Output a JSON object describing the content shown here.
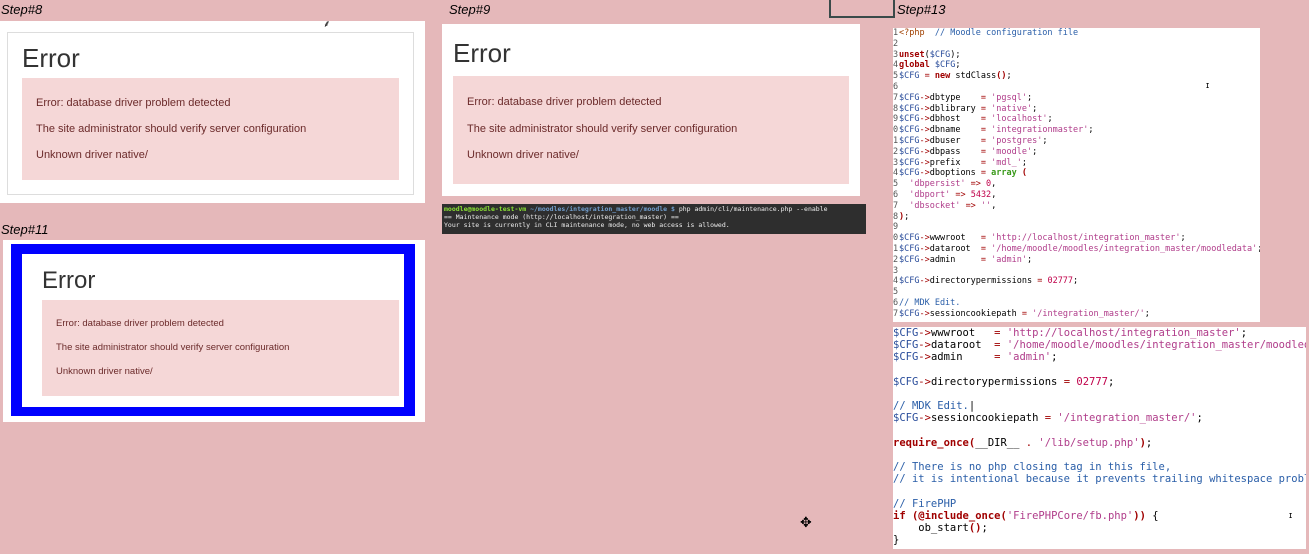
{
  "steps": {
    "step8": "Step#8",
    "step9": "Step#9",
    "step11": "Step#11",
    "step13": "Step#13"
  },
  "error": {
    "title": "Error",
    "line1": "Error: database driver problem detected",
    "line2": "The site administrator should verify server configuration",
    "line3": "Unknown driver native/"
  },
  "terminal": {
    "prompt_user": "moodle@moodle-test-vm",
    "prompt_path": "~/moodles/integration_master/moodle $",
    "command": " php admin/cli/maintenance.php --enable",
    "out1": "== Maintenance mode (http://localhost/integration_master) ==",
    "out2": "Your site is currently in CLI maintenance mode, no web access is allowed."
  },
  "colors": {
    "background": "#e5b8ba",
    "alert_bg": "#f5d7d7",
    "frame_blue": "#0000ff"
  }
}
